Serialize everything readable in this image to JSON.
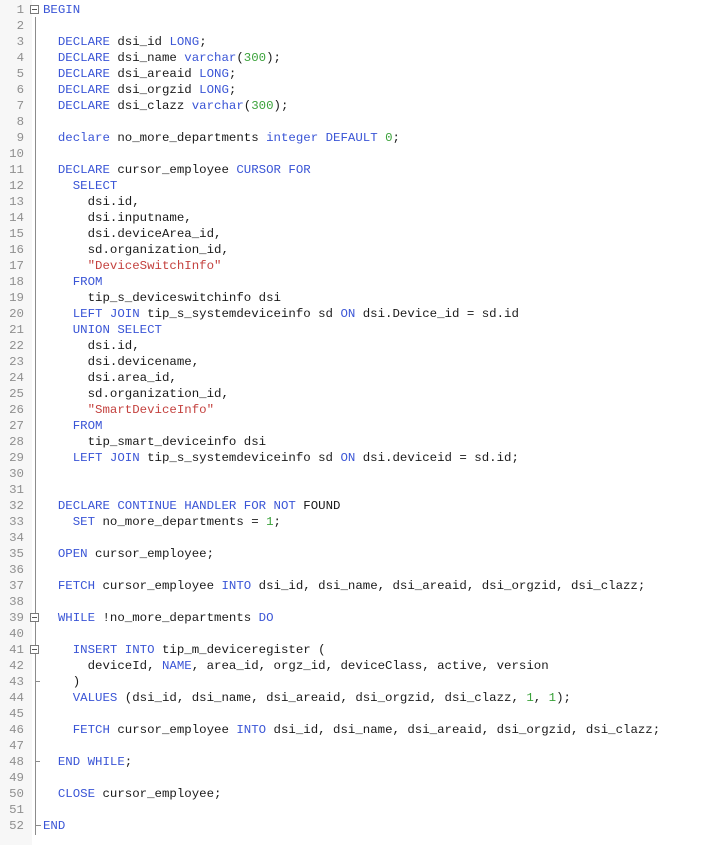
{
  "editor": {
    "language": "sql",
    "colors": {
      "keyword": "#3a55d6",
      "string": "#c4423f",
      "number": "#3aa23a",
      "text": "#1a1a1a",
      "line_number": "#8f8f8f",
      "gutter_bg": "#f7f7f7"
    },
    "fold_markers": {
      "open": [
        1,
        39,
        41
      ],
      "close": [
        43,
        48
      ],
      "final": [
        52
      ]
    },
    "lines": [
      {
        "n": "1",
        "tokens": [
          [
            "kw",
            "BEGIN"
          ]
        ]
      },
      {
        "n": "2",
        "tokens": []
      },
      {
        "n": "3",
        "tokens": [
          [
            "id",
            "  "
          ],
          [
            "kw",
            "DECLARE"
          ],
          [
            "id",
            " dsi_id "
          ],
          [
            "kw",
            "LONG"
          ],
          [
            "id",
            ";"
          ]
        ]
      },
      {
        "n": "4",
        "tokens": [
          [
            "id",
            "  "
          ],
          [
            "kw",
            "DECLARE"
          ],
          [
            "id",
            " dsi_name "
          ],
          [
            "kw",
            "varchar"
          ],
          [
            "id",
            "("
          ],
          [
            "num",
            "300"
          ],
          [
            "id",
            ");"
          ]
        ]
      },
      {
        "n": "5",
        "tokens": [
          [
            "id",
            "  "
          ],
          [
            "kw",
            "DECLARE"
          ],
          [
            "id",
            " dsi_areaid "
          ],
          [
            "kw",
            "LONG"
          ],
          [
            "id",
            ";"
          ]
        ]
      },
      {
        "n": "6",
        "tokens": [
          [
            "id",
            "  "
          ],
          [
            "kw",
            "DECLARE"
          ],
          [
            "id",
            " dsi_orgzid "
          ],
          [
            "kw",
            "LONG"
          ],
          [
            "id",
            ";"
          ]
        ]
      },
      {
        "n": "7",
        "tokens": [
          [
            "id",
            "  "
          ],
          [
            "kw",
            "DECLARE"
          ],
          [
            "id",
            " dsi_clazz "
          ],
          [
            "kw",
            "varchar"
          ],
          [
            "id",
            "("
          ],
          [
            "num",
            "300"
          ],
          [
            "id",
            ");"
          ]
        ]
      },
      {
        "n": "8",
        "tokens": []
      },
      {
        "n": "9",
        "tokens": [
          [
            "id",
            "  "
          ],
          [
            "kw",
            "declare"
          ],
          [
            "id",
            " no_more_departments "
          ],
          [
            "kw",
            "integer"
          ],
          [
            "id",
            " "
          ],
          [
            "kw",
            "DEFAULT"
          ],
          [
            "id",
            " "
          ],
          [
            "num",
            "0"
          ],
          [
            "id",
            ";"
          ]
        ]
      },
      {
        "n": "10",
        "tokens": []
      },
      {
        "n": "11",
        "tokens": [
          [
            "id",
            "  "
          ],
          [
            "kw",
            "DECLARE"
          ],
          [
            "id",
            " cursor_employee "
          ],
          [
            "kw",
            "CURSOR"
          ],
          [
            "id",
            " "
          ],
          [
            "kw",
            "FOR"
          ]
        ]
      },
      {
        "n": "12",
        "tokens": [
          [
            "id",
            "    "
          ],
          [
            "kw",
            "SELECT"
          ]
        ]
      },
      {
        "n": "13",
        "tokens": [
          [
            "id",
            "      dsi.id,"
          ]
        ]
      },
      {
        "n": "14",
        "tokens": [
          [
            "id",
            "      dsi.inputname,"
          ]
        ]
      },
      {
        "n": "15",
        "tokens": [
          [
            "id",
            "      dsi.deviceArea_id,"
          ]
        ]
      },
      {
        "n": "16",
        "tokens": [
          [
            "id",
            "      sd.organization_id,"
          ]
        ]
      },
      {
        "n": "17",
        "tokens": [
          [
            "id",
            "      "
          ],
          [
            "str",
            "\"DeviceSwitchInfo\""
          ]
        ]
      },
      {
        "n": "18",
        "tokens": [
          [
            "id",
            "    "
          ],
          [
            "kw",
            "FROM"
          ]
        ]
      },
      {
        "n": "19",
        "tokens": [
          [
            "id",
            "      tip_s_deviceswitchinfo dsi"
          ]
        ]
      },
      {
        "n": "20",
        "tokens": [
          [
            "id",
            "    "
          ],
          [
            "kw",
            "LEFT JOIN"
          ],
          [
            "id",
            " tip_s_systemdeviceinfo sd "
          ],
          [
            "kw",
            "ON"
          ],
          [
            "id",
            " dsi.Device_id = sd.id"
          ]
        ]
      },
      {
        "n": "21",
        "tokens": [
          [
            "id",
            "    "
          ],
          [
            "kw",
            "UNION SELECT"
          ]
        ]
      },
      {
        "n": "22",
        "tokens": [
          [
            "id",
            "      dsi.id,"
          ]
        ]
      },
      {
        "n": "23",
        "tokens": [
          [
            "id",
            "      dsi.devicename,"
          ]
        ]
      },
      {
        "n": "24",
        "tokens": [
          [
            "id",
            "      dsi.area_id,"
          ]
        ]
      },
      {
        "n": "25",
        "tokens": [
          [
            "id",
            "      sd.organization_id,"
          ]
        ]
      },
      {
        "n": "26",
        "tokens": [
          [
            "id",
            "      "
          ],
          [
            "str",
            "\"SmartDeviceInfo\""
          ]
        ]
      },
      {
        "n": "27",
        "tokens": [
          [
            "id",
            "    "
          ],
          [
            "kw",
            "FROM"
          ]
        ]
      },
      {
        "n": "28",
        "tokens": [
          [
            "id",
            "      tip_smart_deviceinfo dsi"
          ]
        ]
      },
      {
        "n": "29",
        "tokens": [
          [
            "id",
            "    "
          ],
          [
            "kw",
            "LEFT JOIN"
          ],
          [
            "id",
            " tip_s_systemdeviceinfo sd "
          ],
          [
            "kw",
            "ON"
          ],
          [
            "id",
            " dsi.deviceid = sd.id;"
          ]
        ]
      },
      {
        "n": "30",
        "tokens": []
      },
      {
        "n": "31",
        "tokens": []
      },
      {
        "n": "32",
        "tokens": [
          [
            "id",
            "  "
          ],
          [
            "kw",
            "DECLARE CONTINUE HANDLER FOR NOT"
          ],
          [
            "id",
            " FOUND"
          ]
        ]
      },
      {
        "n": "33",
        "tokens": [
          [
            "id",
            "    "
          ],
          [
            "kw",
            "SET"
          ],
          [
            "id",
            " no_more_departments = "
          ],
          [
            "num",
            "1"
          ],
          [
            "id",
            ";"
          ]
        ]
      },
      {
        "n": "34",
        "tokens": []
      },
      {
        "n": "35",
        "tokens": [
          [
            "id",
            "  "
          ],
          [
            "kw",
            "OPEN"
          ],
          [
            "id",
            " cursor_employee;"
          ]
        ]
      },
      {
        "n": "36",
        "tokens": []
      },
      {
        "n": "37",
        "tokens": [
          [
            "id",
            "  "
          ],
          [
            "kw",
            "FETCH"
          ],
          [
            "id",
            " cursor_employee "
          ],
          [
            "kw",
            "INTO"
          ],
          [
            "id",
            " dsi_id, dsi_name, dsi_areaid, dsi_orgzid, dsi_clazz;"
          ]
        ]
      },
      {
        "n": "38",
        "tokens": []
      },
      {
        "n": "39",
        "tokens": [
          [
            "id",
            "  "
          ],
          [
            "kw",
            "WHILE"
          ],
          [
            "id",
            " !no_more_departments "
          ],
          [
            "kw",
            "DO"
          ]
        ]
      },
      {
        "n": "40",
        "tokens": []
      },
      {
        "n": "41",
        "tokens": [
          [
            "id",
            "    "
          ],
          [
            "kw",
            "INSERT INTO"
          ],
          [
            "id",
            " tip_m_deviceregister ("
          ]
        ]
      },
      {
        "n": "42",
        "tokens": [
          [
            "id",
            "      deviceId, "
          ],
          [
            "kw",
            "NAME"
          ],
          [
            "id",
            ", area_id, orgz_id, deviceClass, active, version"
          ]
        ]
      },
      {
        "n": "43",
        "tokens": [
          [
            "id",
            "    )"
          ]
        ]
      },
      {
        "n": "44",
        "tokens": [
          [
            "id",
            "    "
          ],
          [
            "kw",
            "VALUES"
          ],
          [
            "id",
            " (dsi_id, dsi_name, dsi_areaid, dsi_orgzid, dsi_clazz, "
          ],
          [
            "num",
            "1"
          ],
          [
            "id",
            ", "
          ],
          [
            "num",
            "1"
          ],
          [
            "id",
            ");"
          ]
        ]
      },
      {
        "n": "45",
        "tokens": []
      },
      {
        "n": "46",
        "tokens": [
          [
            "id",
            "    "
          ],
          [
            "kw",
            "FETCH"
          ],
          [
            "id",
            " cursor_employee "
          ],
          [
            "kw",
            "INTO"
          ],
          [
            "id",
            " dsi_id, dsi_name, dsi_areaid, dsi_orgzid, dsi_clazz;"
          ]
        ]
      },
      {
        "n": "47",
        "tokens": []
      },
      {
        "n": "48",
        "tokens": [
          [
            "id",
            "  "
          ],
          [
            "kw",
            "END WHILE"
          ],
          [
            "id",
            ";"
          ]
        ]
      },
      {
        "n": "49",
        "tokens": []
      },
      {
        "n": "50",
        "tokens": [
          [
            "id",
            "  "
          ],
          [
            "kw",
            "CLOSE"
          ],
          [
            "id",
            " cursor_employee;"
          ]
        ]
      },
      {
        "n": "51",
        "tokens": []
      },
      {
        "n": "52",
        "tokens": [
          [
            "kw",
            "END"
          ]
        ]
      }
    ]
  }
}
